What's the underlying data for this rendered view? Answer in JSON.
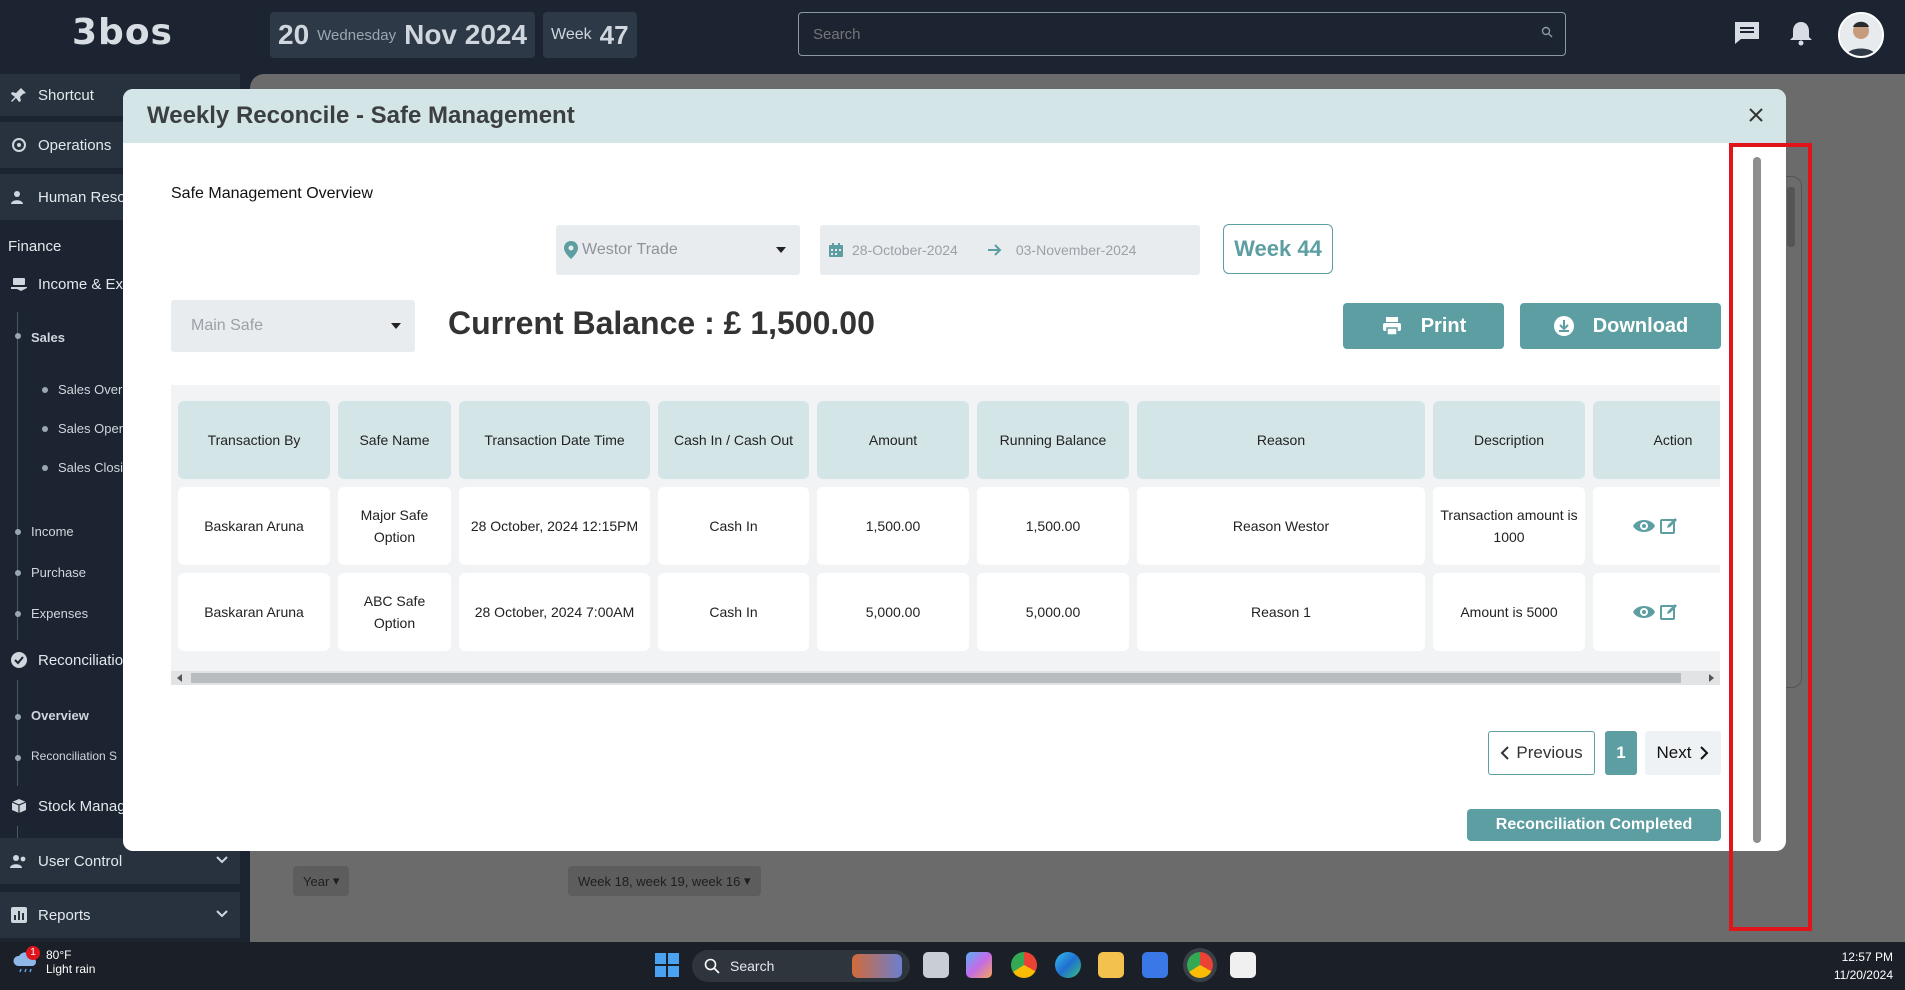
{
  "app": {
    "logo": "3bos",
    "date_day": "20",
    "date_weekday": "Wednesday",
    "date_month_year": "Nov 2024",
    "week_label": "Week",
    "week_number": "47",
    "search_placeholder": "Search"
  },
  "sidebar": {
    "shortcut": "Shortcut",
    "operations": "Operations",
    "human_resources": "Human Reso",
    "finance": "Finance",
    "income_expense": "Income & Ex",
    "sales": "Sales",
    "sales_overview": "Sales Over",
    "sales_opening": "Sales Open",
    "sales_closing": "Sales Closi",
    "income": "Income",
    "purchase": "Purchase",
    "expenses": "Expenses",
    "reconciliation": "Reconciliatio",
    "overview": "Overview",
    "reconciliation_s": "Reconciliation S",
    "stock_management": "Stock Manag",
    "user_control": "User Control",
    "reports": "Reports"
  },
  "background": {
    "year_filter": "Year",
    "weeks_filter": "Week 18, week 19, week 16"
  },
  "modal": {
    "title": "Weekly Reconcile  - Safe Management",
    "subtitle": "Safe Management Overview",
    "location_placeholder": "Westor Trade",
    "date_from": "28-October-2024",
    "date_to": "03-November-2024",
    "week_button": "Week 44",
    "safe_placeholder": "Main Safe",
    "balance": "Current Balance : £ 1,500.00",
    "print_label": "Print",
    "download_label": "Download",
    "columns": [
      "Transaction By",
      "Safe Name",
      "Transaction Date Time",
      "Cash In / Cash Out",
      "Amount",
      "Running Balance",
      "Reason",
      "Description",
      "Action"
    ],
    "rows": [
      [
        "Baskaran Aruna",
        "Major Safe Option",
        "28 October, 2024 12:15PM",
        "Cash In",
        "1,500.00",
        "1,500.00",
        "Reason Westor",
        "Transaction amount is 1000"
      ],
      [
        "Baskaran Aruna",
        "ABC Safe Option",
        "28 October, 2024 7:00AM",
        "Cash In",
        "5,000.00",
        "5,000.00",
        "Reason 1",
        "Amount is 5000"
      ]
    ],
    "prev_label": "Previous",
    "page_number": "1",
    "next_label": "Next",
    "completed_label": "Reconciliation Completed"
  },
  "taskbar": {
    "temperature": "80°F",
    "weather": "Light rain",
    "weather_badge": "1",
    "search_label": "Search",
    "time": "12:57 PM",
    "date": "11/20/2024"
  },
  "colors": {
    "accent": "#5c9ea2",
    "header": "#d4e5e7",
    "highlight": "#e0151b",
    "topbar": "#1b2430"
  }
}
